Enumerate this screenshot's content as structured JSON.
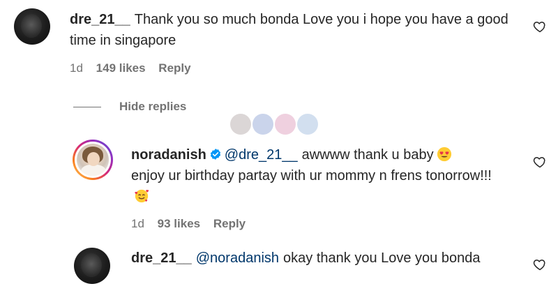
{
  "comments": [
    {
      "username": "dre_21__",
      "text": "Thank you so much bonda Love you i hope you have a good time in singapore",
      "time": "1d",
      "likes": "149 likes",
      "reply_label": "Reply"
    }
  ],
  "hide_replies_label": "Hide replies",
  "replies": [
    {
      "username": "noradanish",
      "mention": "@dre_21__",
      "text_line1": "awwww thank u baby",
      "text_rest": "enjoy ur birthday partay with ur mommy n frens tonorrow!!!",
      "time": "1d",
      "likes": "93 likes",
      "reply_label": "Reply"
    },
    {
      "username": "dre_21__",
      "mention": "@noradanish",
      "text": "okay thank you Love you bonda"
    }
  ],
  "icons": {
    "heart": "heart-outline-icon",
    "verified": "verified-badge-icon",
    "emoji_heart_eyes": "heart-eyes-emoji",
    "emoji_hearts_face": "smiling-face-with-hearts-emoji"
  },
  "colors": {
    "text": "#262626",
    "secondary": "#737373",
    "mention": "#00376b",
    "verified": "#0095f6"
  }
}
